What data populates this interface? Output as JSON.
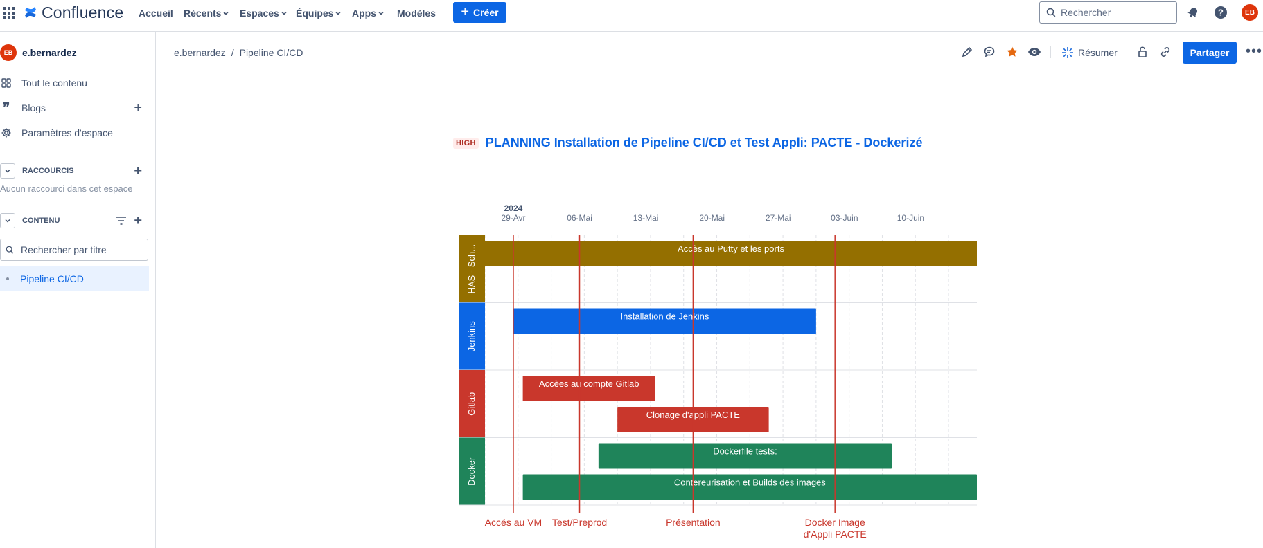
{
  "nav": {
    "logo": "Confluence",
    "items": [
      {
        "label": "Accueil",
        "dropdown": false
      },
      {
        "label": "Récents",
        "dropdown": true
      },
      {
        "label": "Espaces",
        "dropdown": true
      },
      {
        "label": "Équipes",
        "dropdown": true
      },
      {
        "label": "Apps",
        "dropdown": true
      },
      {
        "label": "Modèles",
        "dropdown": false
      }
    ],
    "create_label": "Créer",
    "search_placeholder": "Rechercher",
    "user_initials": "EB"
  },
  "sidebar": {
    "space_name": "e.bernardez",
    "space_initials": "EB",
    "items": [
      {
        "label": "Tout le contenu",
        "icon": "grid-icon"
      },
      {
        "label": "Blogs",
        "icon": "quote-icon"
      },
      {
        "label": "Paramètres d'espace",
        "icon": "gear-icon"
      }
    ],
    "shortcuts_label": "RACCOURCIS",
    "shortcuts_empty": "Aucun raccourci dans cet espace",
    "content_label": "CONTENU",
    "filter_placeholder": "Rechercher par titre",
    "tree": [
      {
        "label": "Pipeline CI/CD",
        "selected": true
      }
    ]
  },
  "page": {
    "breadcrumb": [
      "e.bernardez",
      "Pipeline CI/CD"
    ],
    "summarize_label": "Résumer",
    "share_label": "Partager",
    "lozenge": "HIGH",
    "title": "PLANNING Installation de Pipeline CI/CD et Test Appli: PACTE - Dockerizé"
  },
  "colors": {
    "accent": "#0c66e4",
    "has": "#946f00",
    "jenkins": "#0c66e4",
    "gitlab": "#c9372c",
    "docker": "#1f845a",
    "marker": "#c9372c"
  },
  "chart_data": {
    "type": "gantt",
    "year": "2024",
    "axis_labels": [
      "29-Avr",
      "06-Mai",
      "13-Mai",
      "20-Mai",
      "27-Mai",
      "03-Juin",
      "10-Juin"
    ],
    "axis_dates": [
      "2024-04-29",
      "2024-05-06",
      "2024-05-13",
      "2024-05-20",
      "2024-05-27",
      "2024-06-03",
      "2024-06-10"
    ],
    "range": [
      "2024-04-26",
      "2024-06-17"
    ],
    "lanes": [
      {
        "name": "HAS - Sch...",
        "color": "#946f00",
        "bars": [
          {
            "label": "Accès au Putty et les ports",
            "start": "2024-04-26",
            "end": "2024-06-17"
          }
        ]
      },
      {
        "name": "Jenkins",
        "color": "#0c66e4",
        "bars": [
          {
            "label": "Installation de Jenkins",
            "start": "2024-04-29",
            "end": "2024-05-31"
          }
        ]
      },
      {
        "name": "Gitlab",
        "color": "#c9372c",
        "bars": [
          {
            "label": "Accèes au compte Gitlab",
            "start": "2024-04-30",
            "end": "2024-05-14"
          },
          {
            "label": "Clonage d'appli PACTE",
            "start": "2024-05-10",
            "end": "2024-05-26"
          }
        ]
      },
      {
        "name": "Docker",
        "color": "#1f845a",
        "bars": [
          {
            "label": "Dockerfile tests:",
            "start": "2024-05-08",
            "end": "2024-06-08"
          },
          {
            "label": "Contereurisation et Builds des images",
            "start": "2024-04-30",
            "end": "2024-06-17"
          }
        ]
      }
    ],
    "markers": [
      {
        "label": "Accés au VM",
        "date": "2024-04-29"
      },
      {
        "label": "Test/Preprod",
        "date": "2024-05-06"
      },
      {
        "label": "Présentation",
        "date": "2024-05-18"
      },
      {
        "label": "Docker Image d'Appli PACTE",
        "date": "2024-06-02"
      }
    ]
  }
}
